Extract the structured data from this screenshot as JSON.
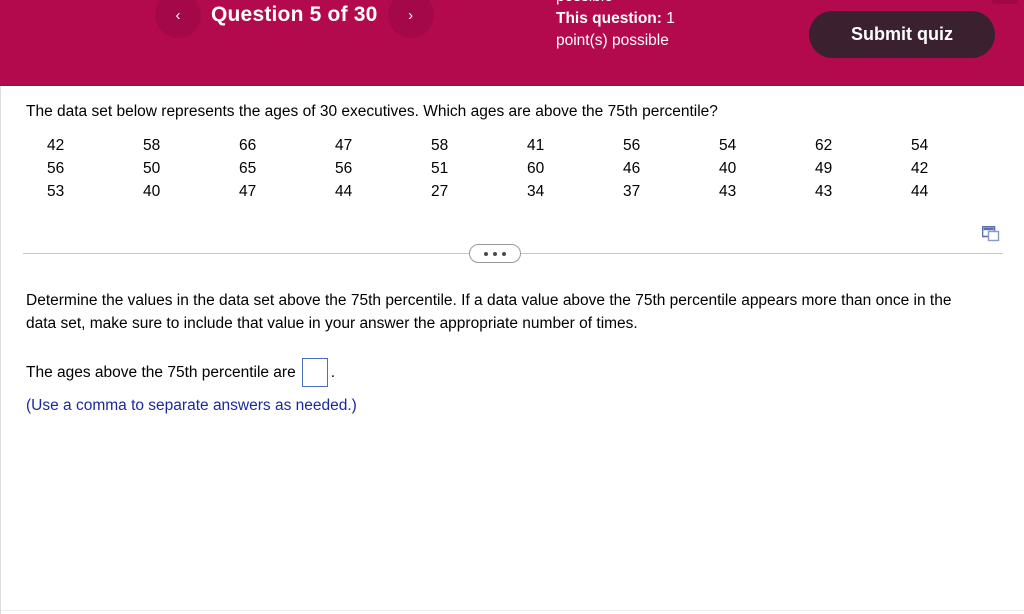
{
  "header": {
    "prev_label": "‹",
    "next_label": "›",
    "question_title": "Question 5 of 30",
    "points_clipped_line": "possible",
    "points_label": "This question:",
    "points_value": "1",
    "points_line2": "point(s) possible",
    "submit_label": "Submit quiz",
    "background_color": "#b30a4e",
    "submit_color": "#3b2030"
  },
  "question": {
    "prompt": "The data set below represents the ages of 30 executives. Which ages are above the 75th percentile?",
    "data_rows": [
      [
        "42",
        "58",
        "66",
        "47",
        "58",
        "41",
        "56",
        "54",
        "62",
        "54"
      ],
      [
        "56",
        "50",
        "65",
        "56",
        "51",
        "60",
        "46",
        "40",
        "49",
        "42"
      ],
      [
        "53",
        "40",
        "47",
        "44",
        "27",
        "34",
        "37",
        "43",
        "43",
        "44"
      ]
    ],
    "popout_icon": "popout-window-icon",
    "expander_label": "•••"
  },
  "answer_section": {
    "instruction": "Determine the values in the data set above the 75th percentile. If a data value above the 75th percentile appears more than once in the data set, make sure to include that value in your answer the appropriate number of times.",
    "answer_prefix": "The ages above the 75th percentile are",
    "answer_value": "",
    "answer_placeholder": "",
    "period": ".",
    "hint": "(Use a comma to separate answers as needed.)",
    "hint_color": "#1a2a9c"
  }
}
